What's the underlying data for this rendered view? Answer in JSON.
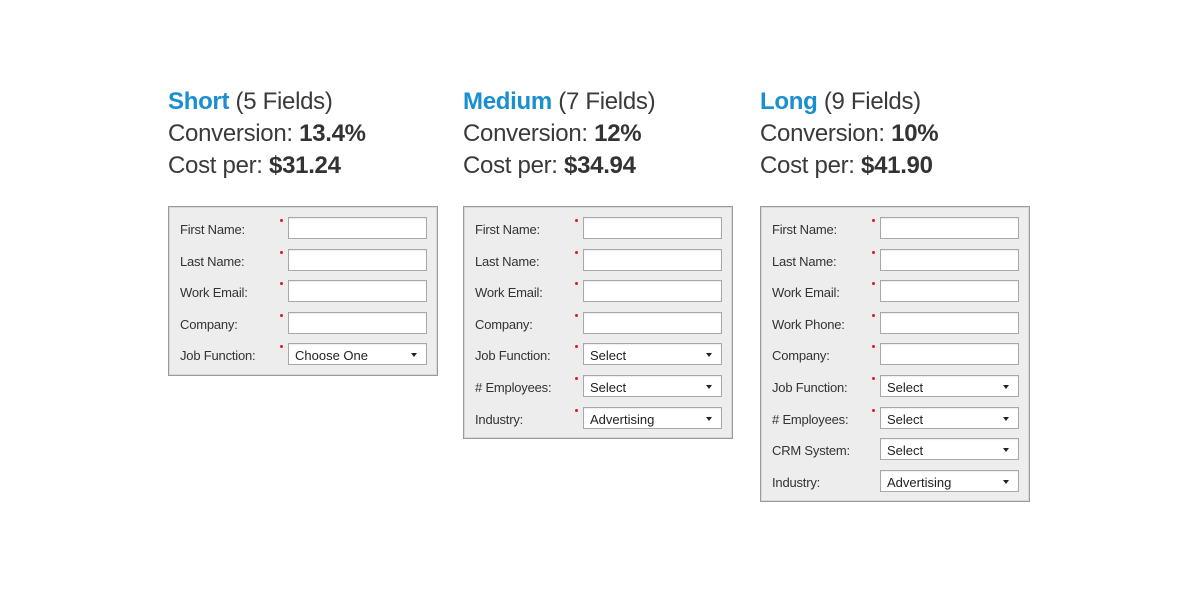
{
  "colors": {
    "accent": "#1a8fd0",
    "required": "#e01b1b"
  },
  "variants": [
    {
      "name": "Short",
      "fields_note": "(5 Fields)",
      "conversion_label": "Conversion:",
      "conversion_value": "13.4%",
      "cost_label": "Cost per:",
      "cost_value": "$31.24",
      "rows": [
        {
          "label": "First Name:",
          "type": "text",
          "value": "",
          "required": true
        },
        {
          "label": "Last Name:",
          "type": "text",
          "value": "",
          "required": true
        },
        {
          "label": "Work Email:",
          "type": "text",
          "value": "",
          "required": true
        },
        {
          "label": "Company:",
          "type": "text",
          "value": "",
          "required": true
        },
        {
          "label": "Job Function:",
          "type": "select",
          "value": "Choose One",
          "required": true
        }
      ]
    },
    {
      "name": "Medium",
      "fields_note": "(7 Fields)",
      "conversion_label": "Conversion:",
      "conversion_value": "12%",
      "cost_label": "Cost per:",
      "cost_value": "$34.94",
      "rows": [
        {
          "label": "First Name:",
          "type": "text",
          "value": "",
          "required": true
        },
        {
          "label": "Last Name:",
          "type": "text",
          "value": "",
          "required": true
        },
        {
          "label": "Work Email:",
          "type": "text",
          "value": "",
          "required": true
        },
        {
          "label": "Company:",
          "type": "text",
          "value": "",
          "required": true
        },
        {
          "label": "Job Function:",
          "type": "select",
          "value": "Select",
          "required": true
        },
        {
          "label": "# Employees:",
          "type": "select",
          "value": "Select",
          "required": true
        },
        {
          "label": "Industry:",
          "type": "select",
          "value": "Advertising",
          "required": true
        }
      ]
    },
    {
      "name": "Long",
      "fields_note": "(9 Fields)",
      "conversion_label": "Conversion:",
      "conversion_value": "10%",
      "cost_label": "Cost per:",
      "cost_value": "$41.90",
      "rows": [
        {
          "label": "First Name:",
          "type": "text",
          "value": "",
          "required": true
        },
        {
          "label": "Last Name:",
          "type": "text",
          "value": "",
          "required": true
        },
        {
          "label": "Work Email:",
          "type": "text",
          "value": "",
          "required": true
        },
        {
          "label": "Work Phone:",
          "type": "text",
          "value": "",
          "required": true
        },
        {
          "label": "Company:",
          "type": "text",
          "value": "",
          "required": true
        },
        {
          "label": "Job Function:",
          "type": "select",
          "value": "Select",
          "required": true
        },
        {
          "label": "# Employees:",
          "type": "select",
          "value": "Select",
          "required": true
        },
        {
          "label": "CRM System:",
          "type": "select",
          "value": "Select",
          "required": false
        },
        {
          "label": "Industry:",
          "type": "select",
          "value": "Advertising",
          "required": false
        }
      ]
    }
  ]
}
